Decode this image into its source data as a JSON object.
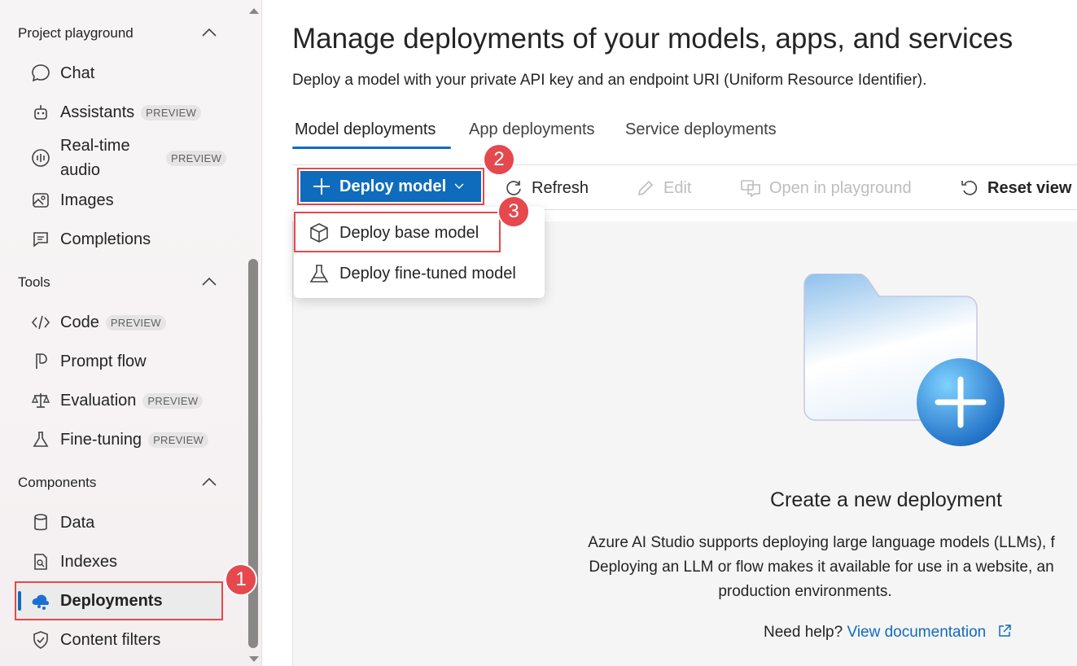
{
  "sidebar": {
    "sections": {
      "playground": {
        "title": "Project playground"
      },
      "tools": {
        "title": "Tools"
      },
      "components": {
        "title": "Components"
      }
    },
    "items": {
      "chat": {
        "label": "Chat"
      },
      "assistants": {
        "label": "Assistants",
        "badge": "PREVIEW"
      },
      "realtime": {
        "label": "Real-time audio",
        "badge": "PREVIEW"
      },
      "images": {
        "label": "Images"
      },
      "completions": {
        "label": "Completions"
      },
      "code": {
        "label": "Code",
        "badge": "PREVIEW"
      },
      "promptflow": {
        "label": "Prompt flow"
      },
      "evaluation": {
        "label": "Evaluation",
        "badge": "PREVIEW"
      },
      "finetuning": {
        "label": "Fine-tuning",
        "badge": "PREVIEW"
      },
      "data": {
        "label": "Data"
      },
      "indexes": {
        "label": "Indexes"
      },
      "deployments": {
        "label": "Deployments"
      },
      "contentfilters": {
        "label": "Content filters"
      }
    }
  },
  "main": {
    "title": "Manage deployments of your models, apps, and services",
    "subtitle": "Deploy a model with your private API key and an endpoint URI (Uniform Resource Identifier).",
    "tabs": [
      {
        "label": "Model deployments"
      },
      {
        "label": "App deployments"
      },
      {
        "label": "Service deployments"
      }
    ],
    "toolbar": {
      "deploy": "Deploy model",
      "refresh": "Refresh",
      "edit": "Edit",
      "open_playground": "Open in playground",
      "reset_view": "Reset view"
    },
    "menu": {
      "base": "Deploy base model",
      "finetuned": "Deploy fine-tuned model"
    },
    "empty": {
      "title": "Create a new deployment",
      "line1": "Azure AI Studio supports deploying large language models (LLMs), f",
      "line2": "Deploying an LLM or flow makes it available for use in a website, an",
      "line3": "production environments.",
      "help_prefix": "Need help?",
      "help_link": "View documentation"
    }
  },
  "annotations": {
    "step1": "1",
    "step2": "2",
    "step3": "3"
  },
  "colors": {
    "accent": "#0f6cbd",
    "callout": "#e5484d"
  }
}
